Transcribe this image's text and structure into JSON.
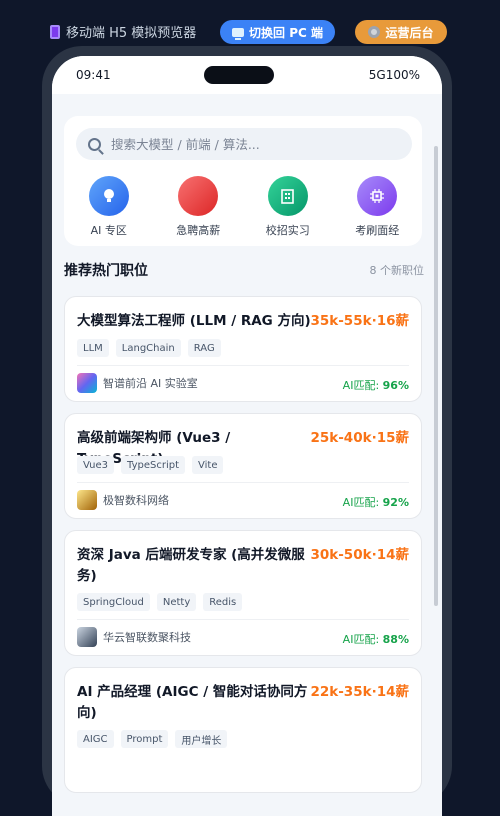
{
  "topbar": {
    "title": "移动端 H5 模拟预览器",
    "switch_pc_label": "切换回 PC 端",
    "admin_label": "运营后台"
  },
  "status": {
    "time": "09:41",
    "network": "5G",
    "battery": "100%"
  },
  "search": {
    "placeholder": "搜索大模型 / 前端 / 算法..."
  },
  "quick_entries": [
    {
      "label": "AI 专区",
      "icon": "lightbulb-icon",
      "color": "#3b82f6"
    },
    {
      "label": "急聘高薪",
      "icon": "flame-icon",
      "color": "#ef4444"
    },
    {
      "label": "校招实习",
      "icon": "building-icon",
      "color": "#10b981"
    },
    {
      "label": "考刷面经",
      "icon": "chip-icon",
      "color": "#8b5cf6"
    }
  ],
  "section": {
    "title": "推荐热门职位",
    "count": "8 个新职位"
  },
  "jobs": [
    {
      "title": "大模型算法工程师 (LLM / RAG 方向)",
      "salary": "35k-55k·16薪",
      "tags": [
        "LLM",
        "LangChain",
        "RAG"
      ],
      "company": "智谱前沿 AI 实验室",
      "match_label": "AI匹配: ",
      "match_value": "96%"
    },
    {
      "title": "高级前端架构师 (Vue3 / TypeScript)",
      "salary": "25k-40k·15薪",
      "tags": [
        "Vue3",
        "TypeScript",
        "Vite"
      ],
      "company": "极智数科网络",
      "match_label": "AI匹配: ",
      "match_value": "92%"
    },
    {
      "title": "资深 Java 后端研发专家 (高并发微服务)",
      "salary": "30k-50k·14薪",
      "tags": [
        "SpringCloud",
        "Netty",
        "Redis"
      ],
      "company": "华云智联数聚科技",
      "match_label": "AI匹配: ",
      "match_value": "88%"
    },
    {
      "title": "AI 产品经理 (AIGC / 智能对话协同方向)",
      "salary": "22k-35k·14薪",
      "tags": [
        "AIGC",
        "Prompt",
        "用户增长"
      ]
    }
  ]
}
